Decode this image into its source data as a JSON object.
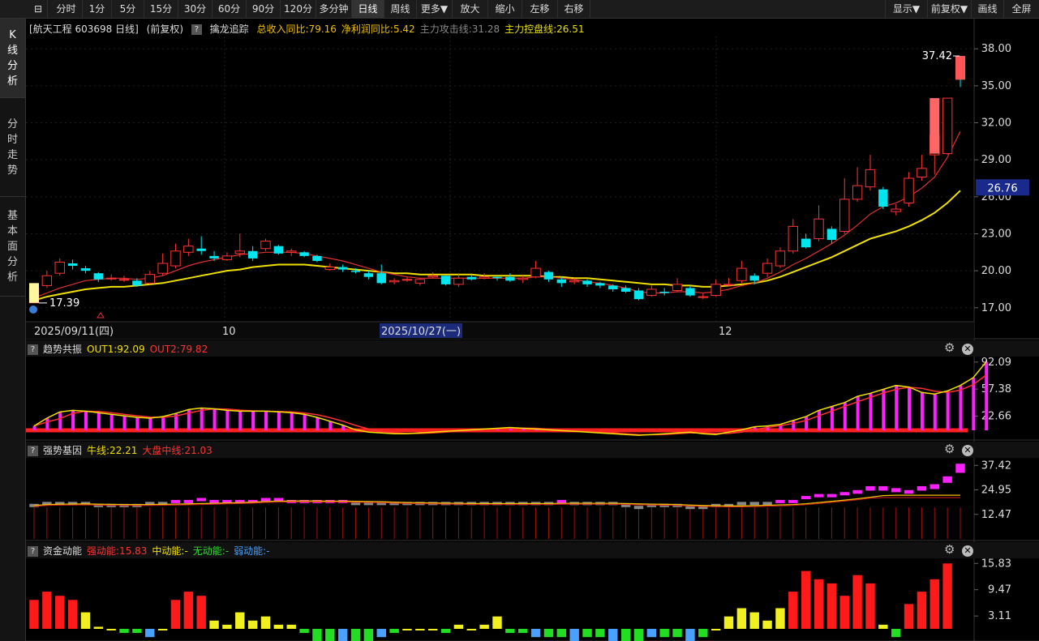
{
  "toolbar": {
    "logo": "⊟",
    "periods": [
      "分时",
      "1分",
      "5分",
      "15分",
      "30分",
      "60分",
      "90分",
      "120分",
      "多分钟",
      "日线",
      "周线",
      "更多▼",
      "放大",
      "缩小",
      "左移",
      "右移"
    ],
    "active_period": "日线",
    "right": [
      "显示▼",
      "前复权▼",
      "画线",
      "全屏"
    ]
  },
  "sidebar": [
    {
      "label": "K线分析",
      "active": true
    },
    {
      "label": "分时走势",
      "active": false
    },
    {
      "label": "基本面分析",
      "active": false
    }
  ],
  "main_panel": {
    "title": "[航天工程 603698 日线]",
    "adjust": "(前复权)",
    "help": "?",
    "indicator_name": "擒龙追踪",
    "metrics": [
      {
        "text": "总收入同比:79.16",
        "color": "#f0c000"
      },
      {
        "text": "净利润同比:5.42",
        "color": "#f0c000"
      },
      {
        "text": "主力攻击线:31.28",
        "color": "#888888"
      },
      {
        "text": "主力控盘线:26.51",
        "color": "#e8e000"
      }
    ],
    "y_ticks": [
      "38.00",
      "35.00",
      "32.00",
      "29.00",
      "26.00",
      "23.00",
      "20.00",
      "17.00"
    ],
    "current_price": "26.76",
    "high_label": "37.42",
    "low_label": "17.39",
    "x_labels": [
      "2025/09/11(四)",
      "10",
      "2025/10/27(一)",
      "12"
    ]
  },
  "panels": [
    {
      "name": "趋势共振",
      "values": [
        {
          "text": "OUT1:92.09",
          "color": "#f0e000"
        },
        {
          "text": "OUT2:79.82",
          "color": "#ff3333"
        }
      ],
      "y_ticks": [
        "92.09",
        "57.38",
        "22.66"
      ]
    },
    {
      "name": "强势基因",
      "values": [
        {
          "text": "牛线:22.21",
          "color": "#f0e000"
        },
        {
          "text": "大盘中线:21.03",
          "color": "#ff3333"
        }
      ],
      "y_ticks": [
        "37.42",
        "24.95",
        "12.47"
      ]
    },
    {
      "name": "资金动能",
      "values": [
        {
          "text": "强动能:15.83",
          "color": "#ff3333"
        },
        {
          "text": "中动能:-",
          "color": "#f0e000"
        },
        {
          "text": "无动能:-",
          "color": "#33dd33"
        },
        {
          "text": "弱动能:-",
          "color": "#4aa0ff"
        }
      ],
      "y_ticks": [
        "15.83",
        "9.47",
        "3.11"
      ]
    }
  ],
  "chart_data": {
    "type": "candlestick",
    "ylim": [
      16,
      39
    ],
    "candles": [
      [
        17.4,
        18.6,
        19.0,
        17.39
      ],
      [
        18.8,
        19.6,
        20.0,
        18.6
      ],
      [
        19.8,
        20.7,
        21.0,
        19.6
      ],
      [
        20.6,
        20.4,
        20.9,
        20.1
      ],
      [
        20.2,
        20.0,
        20.4,
        19.8
      ],
      [
        19.8,
        19.3,
        19.9,
        19.1
      ],
      [
        19.4,
        19.4,
        19.7,
        19.2
      ],
      [
        19.3,
        19.3,
        19.6,
        19.1
      ],
      [
        19.2,
        18.8,
        19.4,
        18.7
      ],
      [
        19.0,
        19.7,
        20.0,
        18.9
      ],
      [
        19.8,
        20.6,
        21.4,
        19.6
      ],
      [
        20.4,
        21.6,
        22.2,
        20.2
      ],
      [
        21.5,
        22.0,
        22.6,
        21.2
      ],
      [
        21.8,
        21.6,
        22.8,
        21.3
      ],
      [
        21.2,
        21.0,
        21.6,
        20.8
      ],
      [
        20.9,
        21.2,
        21.5,
        20.8
      ],
      [
        21.4,
        21.6,
        23.0,
        21.1
      ],
      [
        21.6,
        21.0,
        22.0,
        20.8
      ],
      [
        21.8,
        22.4,
        22.6,
        21.6
      ],
      [
        22.0,
        21.4,
        22.1,
        21.3
      ],
      [
        21.5,
        21.6,
        21.8,
        21.2
      ],
      [
        21.5,
        21.2,
        21.6,
        21.1
      ],
      [
        21.2,
        20.8,
        21.3,
        20.7
      ],
      [
        20.1,
        20.3,
        20.6,
        20.0
      ],
      [
        20.3,
        20.1,
        20.5,
        19.9
      ],
      [
        20.0,
        19.9,
        20.2,
        19.8
      ],
      [
        19.8,
        19.5,
        20.0,
        19.3
      ],
      [
        19.8,
        19.0,
        20.5,
        18.9
      ],
      [
        19.1,
        19.2,
        19.4,
        18.9
      ],
      [
        19.3,
        19.3,
        19.5,
        19.1
      ],
      [
        19.0,
        19.3,
        19.4,
        18.8
      ],
      [
        19.5,
        19.6,
        19.9,
        19.4
      ],
      [
        19.6,
        18.9,
        19.7,
        18.8
      ],
      [
        18.9,
        19.4,
        19.8,
        18.7
      ],
      [
        19.5,
        19.3,
        19.7,
        19.2
      ],
      [
        19.4,
        19.5,
        19.8,
        19.3
      ],
      [
        19.5,
        19.4,
        19.6,
        19.2
      ],
      [
        19.5,
        19.2,
        19.8,
        19.1
      ],
      [
        19.3,
        19.4,
        19.6,
        19.0
      ],
      [
        19.5,
        20.2,
        20.8,
        19.4
      ],
      [
        19.9,
        19.3,
        20.0,
        19.1
      ],
      [
        19.3,
        19.0,
        19.5,
        18.7
      ],
      [
        19.1,
        19.2,
        19.4,
        18.9
      ],
      [
        19.2,
        18.9,
        19.3,
        18.7
      ],
      [
        19.0,
        18.8,
        19.1,
        18.6
      ],
      [
        18.8,
        18.5,
        18.9,
        18.3
      ],
      [
        18.6,
        18.3,
        18.8,
        18.2
      ],
      [
        18.4,
        17.7,
        18.6,
        17.6
      ],
      [
        18.0,
        18.5,
        18.8,
        17.9
      ],
      [
        18.3,
        18.2,
        18.6,
        18.0
      ],
      [
        18.4,
        18.9,
        19.4,
        18.3
      ],
      [
        18.6,
        18.0,
        18.8,
        17.9
      ],
      [
        17.9,
        17.9,
        18.2,
        17.7
      ],
      [
        18.0,
        18.9,
        19.3,
        17.9
      ],
      [
        18.9,
        18.9,
        19.4,
        18.7
      ],
      [
        19.2,
        20.2,
        20.8,
        19.0
      ],
      [
        19.6,
        19.2,
        19.8,
        18.9
      ],
      [
        19.8,
        20.6,
        21.0,
        19.5
      ],
      [
        20.4,
        21.6,
        21.9,
        20.2
      ],
      [
        21.6,
        23.6,
        24.2,
        21.4
      ],
      [
        22.6,
        21.9,
        23.0,
        21.8
      ],
      [
        22.6,
        24.2,
        25.3,
        22.4
      ],
      [
        23.4,
        22.5,
        23.6,
        22.2
      ],
      [
        23.2,
        25.8,
        27.5,
        23.0
      ],
      [
        25.8,
        26.9,
        28.4,
        25.6
      ],
      [
        26.8,
        28.2,
        29.4,
        26.5
      ],
      [
        26.6,
        25.2,
        26.8,
        25.0
      ],
      [
        24.8,
        25.0,
        25.4,
        24.5
      ],
      [
        25.5,
        27.5,
        28.0,
        25.2
      ],
      [
        27.6,
        28.3,
        29.4,
        27.3
      ],
      [
        29.4,
        31.0,
        31.9,
        27.8
      ],
      [
        29.5,
        34.0,
        34.0,
        29.4
      ],
      [
        37.4,
        35.5,
        37.42,
        34.9
      ]
    ],
    "ma_red": [
      17.8,
      18.2,
      18.6,
      18.9,
      19.2,
      19.3,
      19.4,
      19.4,
      19.3,
      19.4,
      19.6,
      20.0,
      20.4,
      20.7,
      20.9,
      21.1,
      21.3,
      21.4,
      21.5,
      21.5,
      21.5,
      21.4,
      21.2,
      21.0,
      20.8,
      20.5,
      20.2,
      19.9,
      19.7,
      19.5,
      19.4,
      19.4,
      19.4,
      19.4,
      19.4,
      19.4,
      19.4,
      19.4,
      19.4,
      19.5,
      19.5,
      19.4,
      19.3,
      19.1,
      19.0,
      18.8,
      18.6,
      18.3,
      18.2,
      18.2,
      18.3,
      18.3,
      18.2,
      18.3,
      18.5,
      18.8,
      19.0,
      19.4,
      19.9,
      20.5,
      21.0,
      21.6,
      22.2,
      22.9,
      23.7,
      24.6,
      25.2,
      25.5,
      26.0,
      26.7,
      27.6,
      29.2,
      31.3
    ],
    "ma_yellow": [
      17.6,
      17.9,
      18.1,
      18.3,
      18.5,
      18.6,
      18.7,
      18.7,
      18.8,
      18.9,
      19.0,
      19.2,
      19.4,
      19.6,
      19.8,
      20.0,
      20.1,
      20.3,
      20.4,
      20.5,
      20.5,
      20.5,
      20.4,
      20.3,
      20.2,
      20.1,
      20.0,
      19.9,
      19.8,
      19.8,
      19.7,
      19.7,
      19.7,
      19.7,
      19.7,
      19.6,
      19.6,
      19.6,
      19.6,
      19.6,
      19.5,
      19.5,
      19.4,
      19.4,
      19.3,
      19.2,
      19.1,
      19.0,
      18.9,
      18.9,
      18.8,
      18.8,
      18.7,
      18.7,
      18.8,
      18.9,
      19.0,
      19.2,
      19.5,
      19.9,
      20.3,
      20.7,
      21.1,
      21.6,
      22.1,
      22.6,
      22.9,
      23.2,
      23.6,
      24.1,
      24.7,
      25.5,
      26.5
    ],
    "trend_out1": [
      10,
      20,
      28,
      30,
      29,
      27,
      25,
      23,
      21,
      20,
      22,
      26,
      31,
      33,
      32,
      30,
      29,
      29,
      29,
      28,
      27,
      25,
      21,
      16,
      11,
      5,
      2,
      1,
      0,
      0,
      1,
      2,
      3,
      4,
      5,
      6,
      7,
      8,
      7,
      6,
      5,
      4,
      3,
      2,
      1,
      0,
      -1,
      -2,
      -1,
      0,
      1,
      2,
      0,
      -1,
      2,
      5,
      9,
      10,
      12,
      17,
      22,
      30,
      35,
      40,
      48,
      52,
      57,
      62,
      60,
      53,
      51,
      55,
      62,
      72,
      92.09
    ],
    "strong_bars": [
      17,
      18,
      18,
      18,
      18,
      17,
      17,
      17,
      17,
      18,
      18,
      19,
      19,
      20,
      19,
      19,
      19,
      19,
      20,
      20,
      19,
      19,
      19,
      19,
      19,
      18,
      18,
      18,
      18,
      18,
      18,
      18,
      18,
      18,
      18,
      18,
      18,
      18,
      18,
      18,
      18,
      19,
      18,
      18,
      18,
      18,
      17,
      16,
      17,
      17,
      17,
      16,
      16,
      17,
      17,
      18,
      18,
      18,
      19,
      19,
      21,
      22,
      22,
      23,
      24,
      26,
      26,
      25,
      24,
      26,
      27,
      31,
      37.42
    ],
    "money_flow": [
      7,
      9,
      8,
      7,
      4,
      0.5,
      0,
      -1,
      -1,
      -2,
      0,
      7,
      9,
      8,
      2,
      1,
      4,
      2,
      3,
      1,
      1,
      -1,
      -4,
      -4,
      -4,
      -3,
      -3,
      -2,
      -1,
      0,
      0,
      0,
      -1,
      1,
      0,
      1,
      3,
      -1,
      -1,
      -2,
      -2,
      -2,
      -3,
      -2,
      -2,
      -3,
      -3,
      -3,
      -2,
      -2,
      -2,
      -3,
      -2,
      0,
      3,
      5,
      4,
      2,
      5,
      9,
      14,
      12,
      11,
      8,
      13,
      11,
      1,
      -2,
      6,
      9,
      12,
      15.83
    ]
  }
}
